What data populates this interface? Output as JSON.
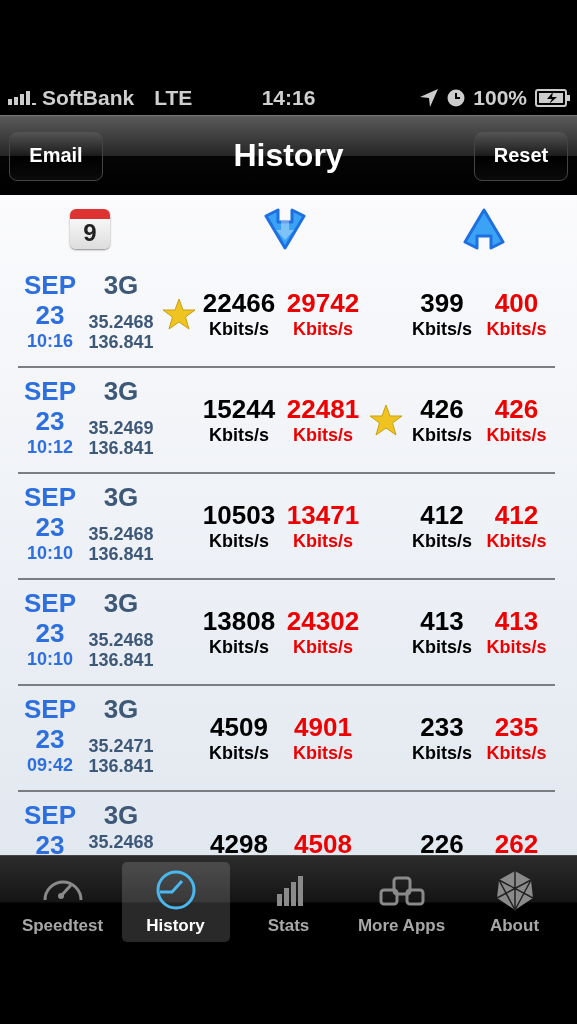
{
  "status_bar": {
    "carrier": "SoftBank",
    "network": "LTE",
    "time": "14:16",
    "battery": "100%"
  },
  "nav_bar": {
    "left_button": "Email",
    "title": "History",
    "right_button": "Reset"
  },
  "header": {
    "calendar_day": "9"
  },
  "rows": [
    {
      "month": "SEP",
      "day": "23",
      "time": "10:16",
      "network": "3G",
      "latitude": "35.2468",
      "longitude": "136.841",
      "down": "22466",
      "down_unit": "Kbits/s",
      "down_max": "29742",
      "down_max_unit": "Kbits/s",
      "up": "399",
      "up_unit": "Kbits/s",
      "up_max": "400",
      "up_max_unit": "Kbits/s",
      "starred_download": true,
      "starred_upload": false
    },
    {
      "month": "SEP",
      "day": "23",
      "time": "10:12",
      "network": "3G",
      "latitude": "35.2469",
      "longitude": "136.841",
      "down": "15244",
      "down_unit": "Kbits/s",
      "down_max": "22481",
      "down_max_unit": "Kbits/s",
      "up": "426",
      "up_unit": "Kbits/s",
      "up_max": "426",
      "up_max_unit": "Kbits/s",
      "starred_download": false,
      "starred_upload": true
    },
    {
      "month": "SEP",
      "day": "23",
      "time": "10:10",
      "network": "3G",
      "latitude": "35.2468",
      "longitude": "136.841",
      "down": "10503",
      "down_unit": "Kbits/s",
      "down_max": "13471",
      "down_max_unit": "Kbits/s",
      "up": "412",
      "up_unit": "Kbits/s",
      "up_max": "412",
      "up_max_unit": "Kbits/s",
      "starred_download": false,
      "starred_upload": false
    },
    {
      "month": "SEP",
      "day": "23",
      "time": "10:10",
      "network": "3G",
      "latitude": "35.2468",
      "longitude": "136.841",
      "down": "13808",
      "down_unit": "Kbits/s",
      "down_max": "24302",
      "down_max_unit": "Kbits/s",
      "up": "413",
      "up_unit": "Kbits/s",
      "up_max": "413",
      "up_max_unit": "Kbits/s",
      "starred_download": false,
      "starred_upload": false
    },
    {
      "month": "SEP",
      "day": "23",
      "time": "09:42",
      "network": "3G",
      "latitude": "35.2471",
      "longitude": "136.841",
      "down": "4509",
      "down_unit": "Kbits/s",
      "down_max": "4901",
      "down_max_unit": "Kbits/s",
      "up": "233",
      "up_unit": "Kbits/s",
      "up_max": "235",
      "up_max_unit": "Kbits/s",
      "starred_download": false,
      "starred_upload": false
    },
    {
      "month": "SEP",
      "day": "23",
      "network": "3G",
      "latitude": "35.2468",
      "down": "4298",
      "down_max": "4508",
      "up": "226",
      "up_max": "262",
      "starred_download": false,
      "starred_upload": false
    }
  ],
  "tab_bar": [
    {
      "label": "Speedtest",
      "kind": "gauge",
      "selected": false
    },
    {
      "label": "History",
      "kind": "clock",
      "selected": true
    },
    {
      "label": "Stats",
      "kind": "bars",
      "selected": false
    },
    {
      "label": "More Apps",
      "kind": "boxes",
      "selected": false
    },
    {
      "label": "About",
      "kind": "emblem",
      "selected": false
    }
  ]
}
